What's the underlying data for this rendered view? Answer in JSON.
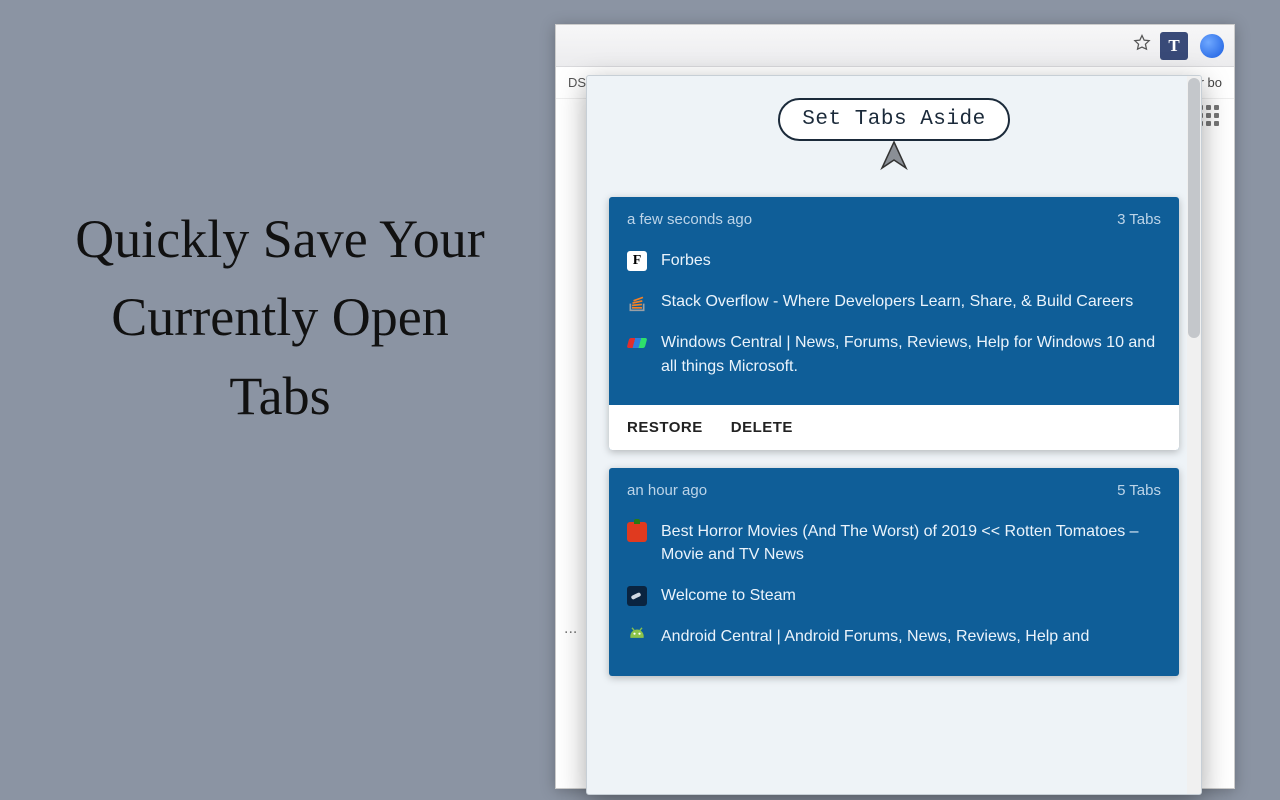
{
  "promo": {
    "headline": "Quickly Save Your Currently Open Tabs"
  },
  "browser": {
    "bookmark_left": "DS",
    "bookmark_right": "r bo",
    "extension_badge": "T"
  },
  "popup": {
    "set_aside_label": "Set Tabs Aside",
    "actions": {
      "restore": "RESTORE",
      "delete": "DELETE"
    },
    "groups": [
      {
        "timestamp": "a few seconds ago",
        "count_label": "3 Tabs",
        "tabs": [
          {
            "favicon": "forbes",
            "title": "Forbes"
          },
          {
            "favicon": "stackoverflow",
            "title": "Stack Overflow - Where Developers Learn, Share, & Build Careers"
          },
          {
            "favicon": "windowscentral",
            "title": "Windows Central | News, Forums, Reviews, Help for Windows 10 and all things Microsoft."
          }
        ]
      },
      {
        "timestamp": "an hour ago",
        "count_label": "5 Tabs",
        "tabs": [
          {
            "favicon": "rottentomatoes",
            "title": "Best Horror Movies (And The Worst) of 2019 << Rotten Tomatoes – Movie and TV News"
          },
          {
            "favicon": "steam",
            "title": "Welcome to Steam"
          },
          {
            "favicon": "androidcentral",
            "title": "Android Central | Android Forums, News, Reviews, Help and"
          }
        ]
      }
    ]
  }
}
